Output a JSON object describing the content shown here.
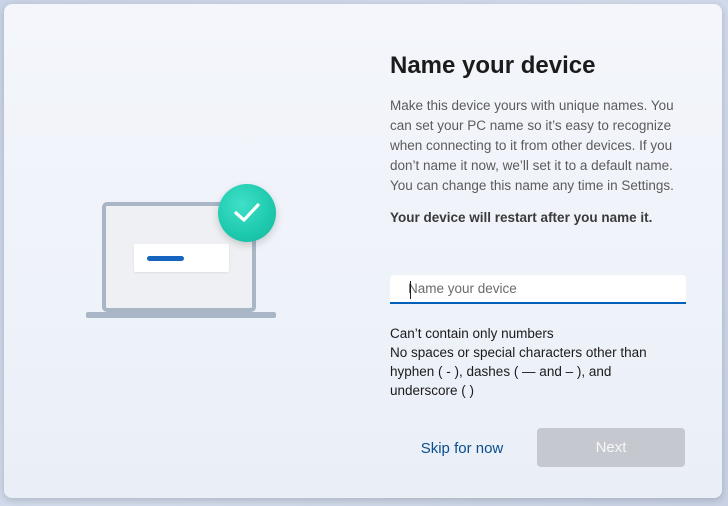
{
  "page": {
    "title": "Name your device",
    "description": "Make this device yours with unique names. You can set your PC name so it’s easy to recognize when connecting to it from other devices. If you don’t name it now, we’ll set it to a default name. You can change this name any time in Settings.",
    "warning": "Your device will restart after you name it."
  },
  "name_input": {
    "placeholder": "Name your device",
    "value": ""
  },
  "rules": [
    "Can’t contain only numbers",
    "No spaces or special characters other than",
    "hyphen ( - ), dashes ( — and – ), and",
    "underscore (    )"
  ],
  "buttons": {
    "skip_label": "Skip for now",
    "next_label": "Next",
    "next_enabled": false
  },
  "illustration": {
    "laptop_icon": "laptop-icon",
    "check_icon": "checkmark-icon",
    "accent_color": "#1dc9ad",
    "bar_color": "#1565c0"
  },
  "colors": {
    "accent": "#005fb8",
    "link": "#0a4f8c",
    "disabled_button": "#c5c9cf"
  }
}
